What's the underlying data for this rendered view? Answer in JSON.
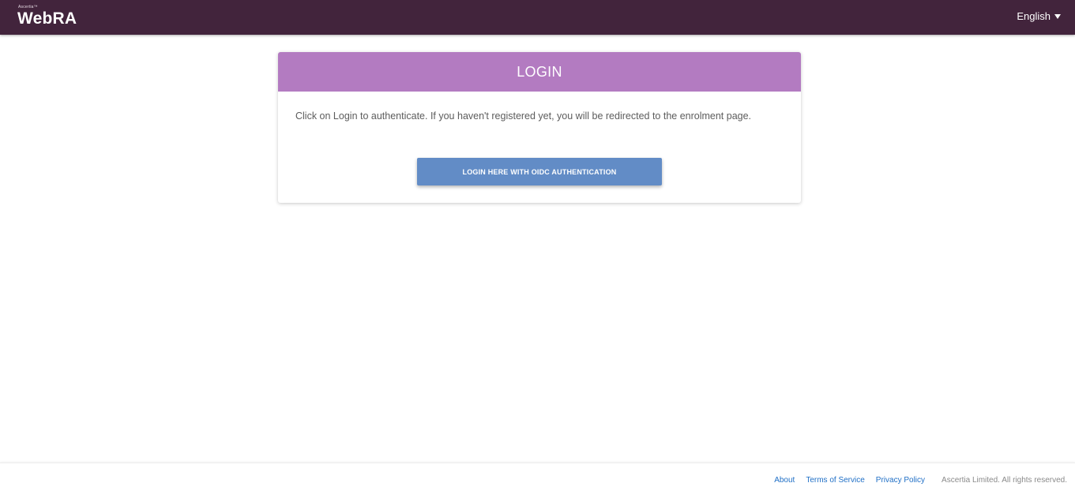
{
  "header": {
    "logo_small": "Ascertia™",
    "logo_main": "WebRA",
    "language": "English"
  },
  "login": {
    "title": "LOGIN",
    "message": "Click on Login to authenticate. If you haven't registered yet, you will be redirected to the enrolment page.",
    "button_label": "LOGIN HERE WITH OIDC AUTHENTICATION"
  },
  "footer": {
    "links": [
      "About",
      "Terms of Service",
      "Privacy Policy"
    ],
    "copyright": "Ascertia Limited. All rights reserved."
  },
  "colors": {
    "topbar": "#42243c",
    "card_header": "#b37bc1",
    "button": "#628cc6",
    "link": "#1f6fc6"
  }
}
